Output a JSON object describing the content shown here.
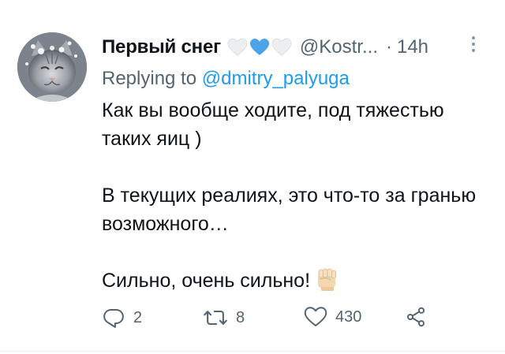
{
  "tweet": {
    "display_name": "Первый снег",
    "handle": "@Kostr...",
    "separator": "·",
    "time": "14h",
    "replying_prefix": "Replying to ",
    "replying_handle": "@dmitry_palyuga",
    "paragraphs": [
      "Как вы вообще ходите, под тяжестью таких яиц )",
      "В текущих реалиях, это что-то за гранью возможного…",
      "Сильно, очень сильно!"
    ]
  },
  "name_emojis": [
    "white-heart-icon",
    "blue-heart-icon",
    "white-heart-icon"
  ],
  "actions": {
    "reply_count": "2",
    "retweet_count": "8",
    "like_count": "430"
  },
  "colors": {
    "text": "#0f1419",
    "secondary": "#536471",
    "link": "#1d9bf0",
    "blue_heart": "#4da3e8",
    "white_heart": "#eceef0"
  }
}
